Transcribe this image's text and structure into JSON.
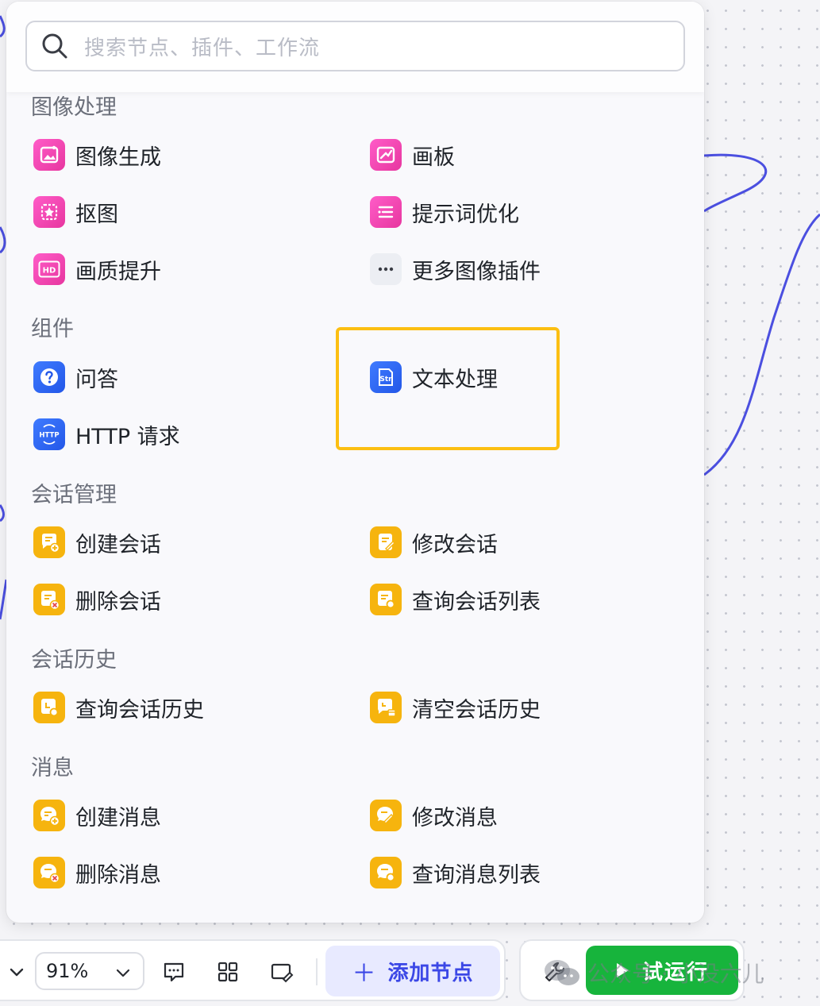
{
  "search": {
    "placeholder": "搜索节点、插件、工作流"
  },
  "sections": {
    "image": {
      "title": "图像处理",
      "items": [
        {
          "label": "图像生成",
          "icon": "image-generate-icon"
        },
        {
          "label": "画板",
          "icon": "canvas-board-icon"
        },
        {
          "label": "抠图",
          "icon": "cutout-icon"
        },
        {
          "label": "提示词优化",
          "icon": "prompt-optimize-icon"
        },
        {
          "label": "画质提升",
          "icon": "hd-quality-icon"
        },
        {
          "label": "更多图像插件",
          "icon": "more-dots-icon"
        }
      ]
    },
    "component": {
      "title": "组件",
      "items": [
        {
          "label": "问答",
          "icon": "question-icon"
        },
        {
          "label": "文本处理",
          "icon": "text-process-icon"
        },
        {
          "label": "HTTP 请求",
          "icon": "http-request-icon"
        }
      ]
    },
    "conversation": {
      "title": "会话管理",
      "items": [
        {
          "label": "创建会话",
          "icon": "create-conversation-icon"
        },
        {
          "label": "修改会话",
          "icon": "edit-conversation-icon"
        },
        {
          "label": "删除会话",
          "icon": "delete-conversation-icon"
        },
        {
          "label": "查询会话列表",
          "icon": "query-conversation-list-icon"
        }
      ]
    },
    "history": {
      "title": "会话历史",
      "items": [
        {
          "label": "查询会话历史",
          "icon": "query-history-icon"
        },
        {
          "label": "清空会话历史",
          "icon": "clear-history-icon"
        }
      ]
    },
    "message": {
      "title": "消息",
      "items": [
        {
          "label": "创建消息",
          "icon": "create-message-icon"
        },
        {
          "label": "修改消息",
          "icon": "edit-message-icon"
        },
        {
          "label": "删除消息",
          "icon": "delete-message-icon"
        },
        {
          "label": "查询消息列表",
          "icon": "query-message-list-icon"
        }
      ]
    }
  },
  "icon_text": {
    "hd": "HD",
    "str": "Str",
    "http": "HTTP"
  },
  "toolbar": {
    "zoom": "91%",
    "add_node": "添加节点",
    "add_node_plus": "＋",
    "run": "试运行"
  },
  "watermark": {
    "text": "公众号 · 小没六儿"
  },
  "colors": {
    "accent_blue": "#3b47e6",
    "run_green": "#17b43c",
    "highlight_yellow": "#fcbf12",
    "icon_pink": "#e7369f",
    "icon_yellow": "#f6b40e",
    "icon_blue": "#2357e8"
  }
}
